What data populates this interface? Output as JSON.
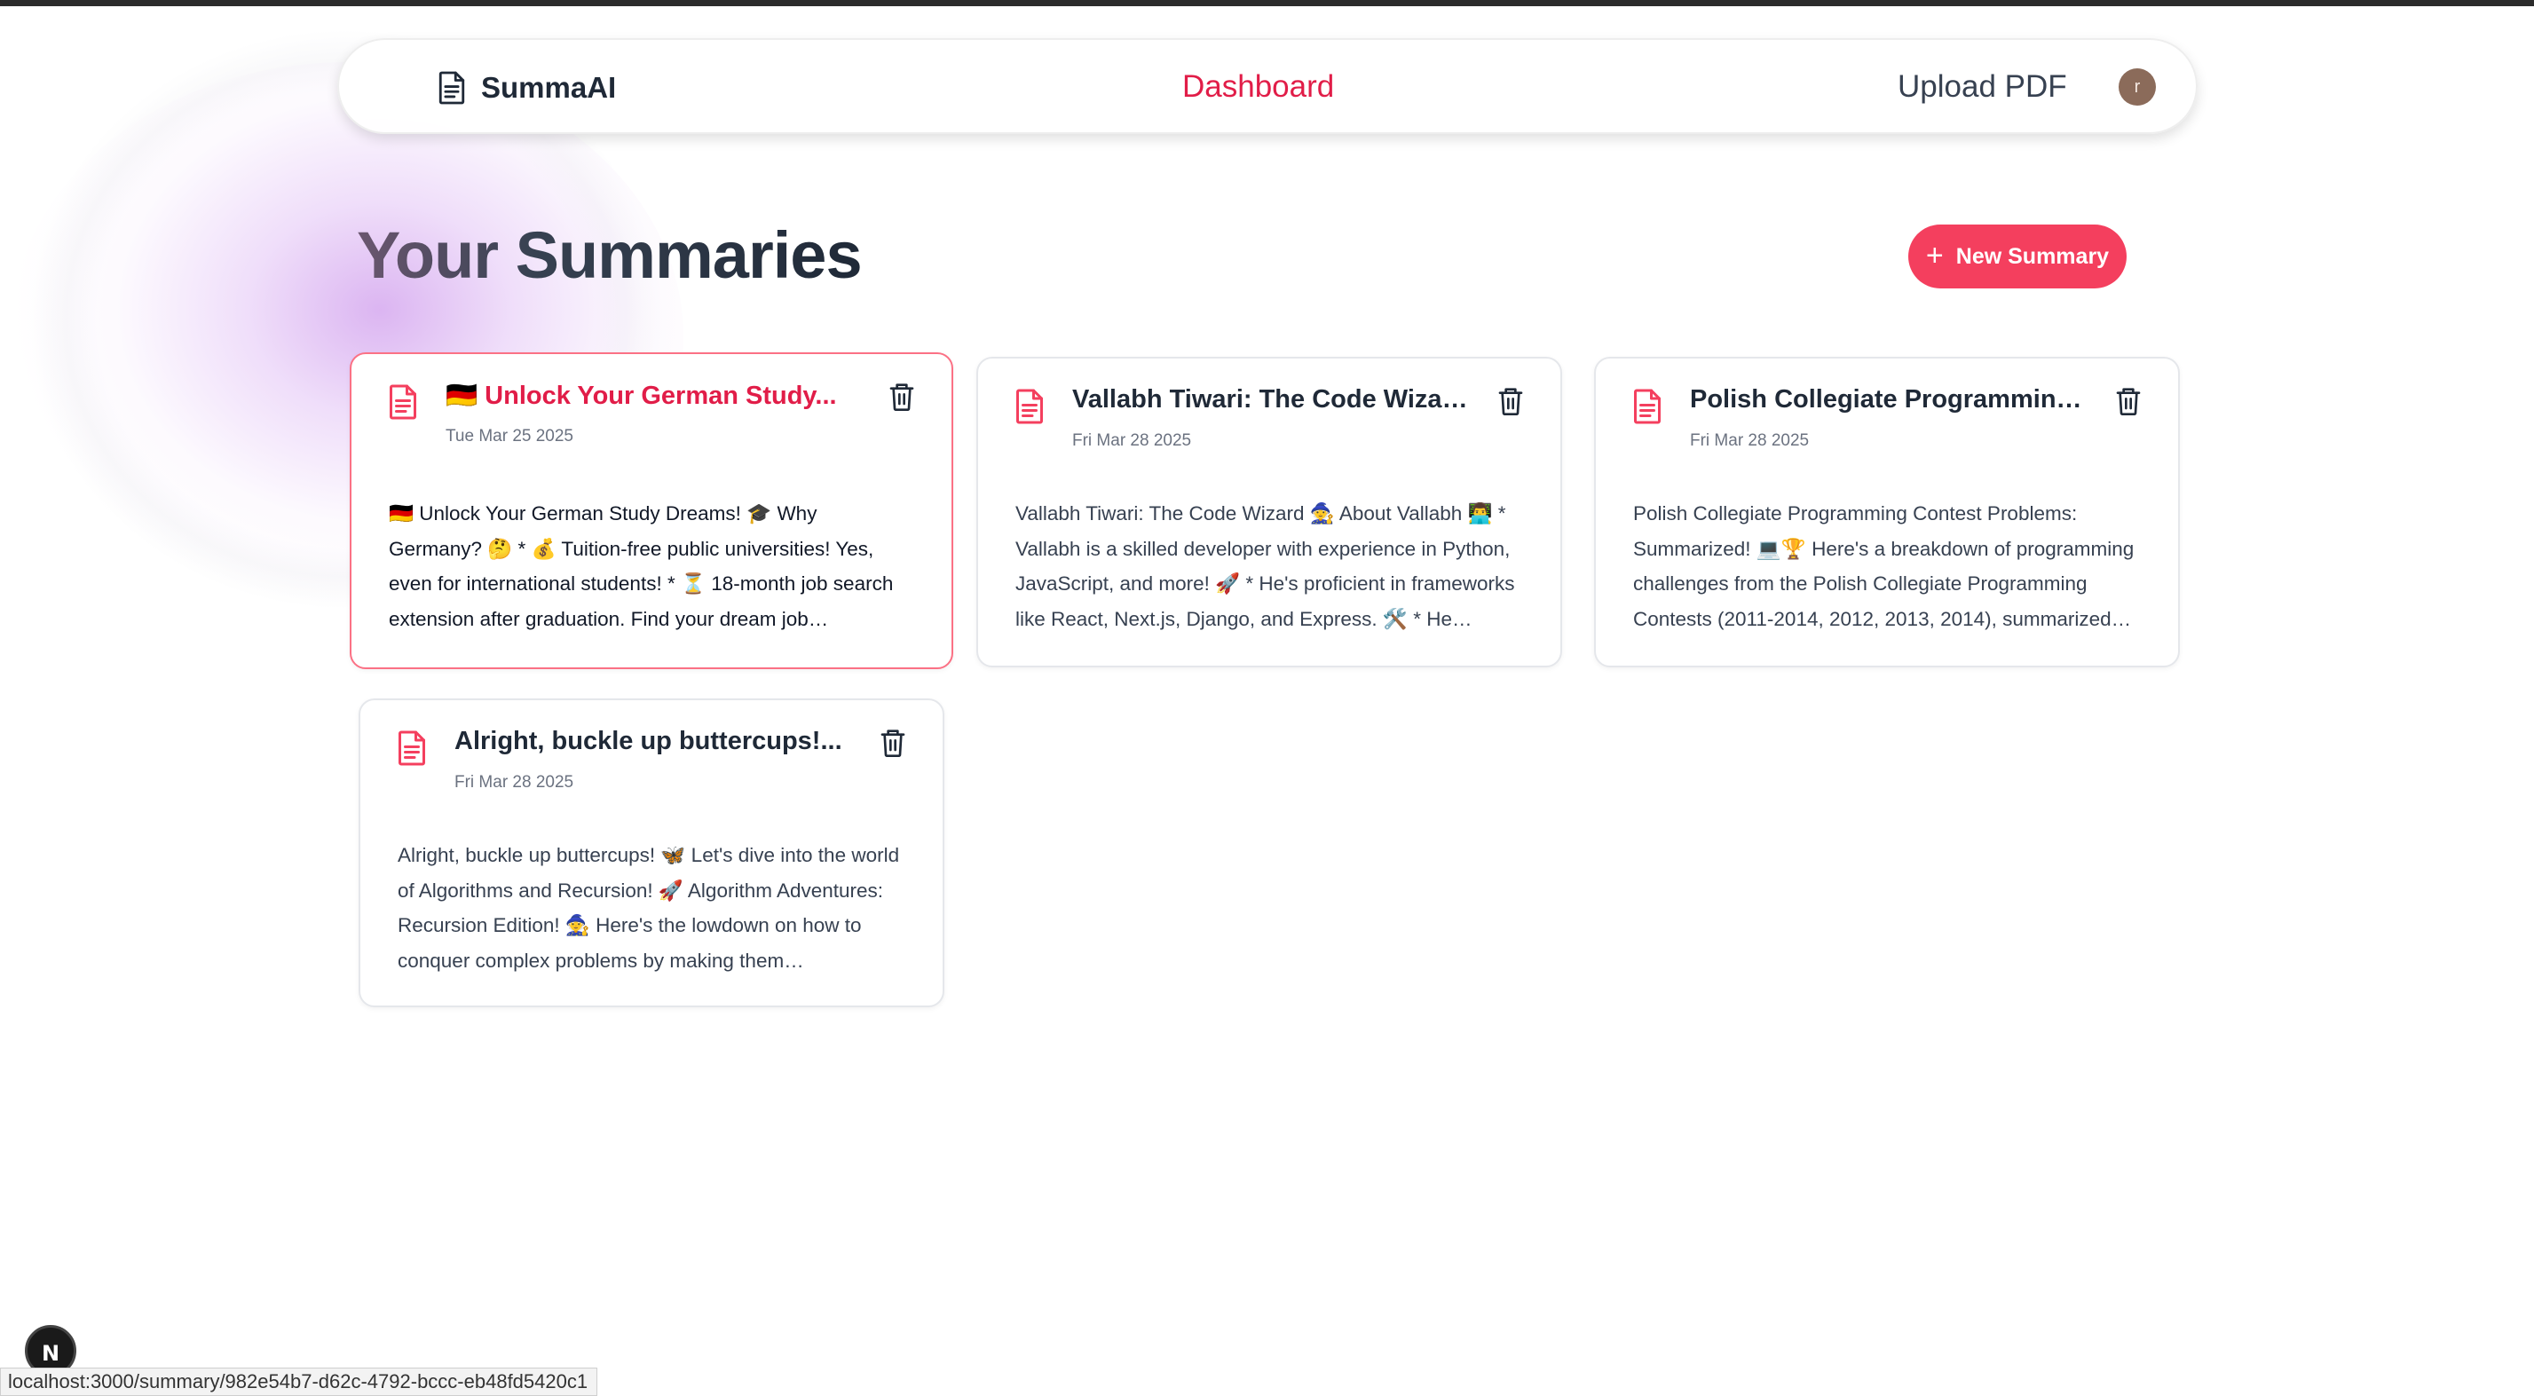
{
  "app": {
    "brand_name": "SummaAI",
    "accent_color": "#e11d48",
    "button_color": "#f43f5e"
  },
  "nav": {
    "dashboard": "Dashboard",
    "upload": "Upload PDF",
    "avatar_initial": "r"
  },
  "page": {
    "title": "Your Summaries",
    "new_button": "New Summary"
  },
  "summaries": [
    {
      "title": "🇩🇪 Unlock Your German Study...",
      "date": "Tue Mar 25 2025",
      "body": "🇩🇪 Unlock Your German Study Dreams! 🎓 Why Germany? 🤔 * 💰 Tuition-free public universities! Yes, even for international students! * ⏳ 18-month job search extension after graduation. Find your dream job…"
    },
    {
      "title": "Vallabh Tiwari: The Code Wizar...",
      "date": "Fri Mar 28 2025",
      "body": "Vallabh Tiwari: The Code Wizard 🧙 About Vallabh 👨‍💻 * Vallabh is a skilled developer with experience in Python, JavaScript, and more! 🚀 * He's proficient in frameworks like React, Next.js, Django, and Express. 🛠️ * He knows…"
    },
    {
      "title": "Polish Collegiate Programming...",
      "date": "Fri Mar 28 2025",
      "body": "Polish Collegiate Programming Contest Problems: Summarized! 💻🏆 Here's a breakdown of programming challenges from the Polish Collegiate Programming Contests (2011-2014, 2012, 2013, 2014), summarized fo…"
    },
    {
      "title": "Alright, buckle up buttercups!...",
      "date": "Fri Mar 28 2025",
      "body": "Alright, buckle up buttercups! 🦋 Let's dive into the world of Algorithms and Recursion! 🚀 Algorithm Adventures: Recursion Edition! 🧙 Here's the lowdown on how to conquer complex problems by making them…"
    }
  ],
  "status_bar": {
    "url": "localhost:3000/summary/982e54b7-d62c-4792-bccc-eb48fd5420c1",
    "badge": "N"
  }
}
